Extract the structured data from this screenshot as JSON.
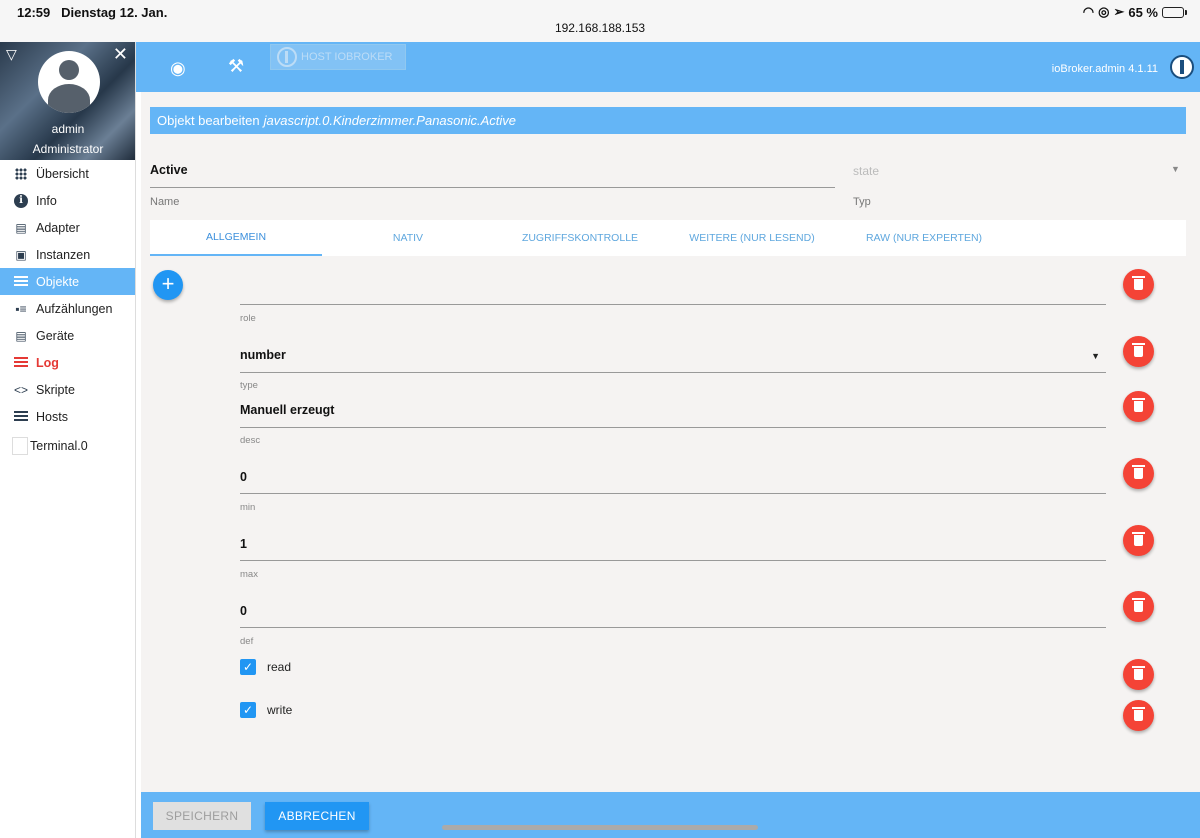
{
  "status_bar": {
    "time": "12:59",
    "date": "Dienstag 12. Jan.",
    "url": "192.168.188.153",
    "battery": "65 %",
    "battery_level": 0.65
  },
  "sidebar": {
    "user_name": "admin",
    "user_role": "Administrator",
    "items": [
      {
        "label": "Übersicht",
        "icon": "apps-grid-icon"
      },
      {
        "label": "Info",
        "icon": "info-icon"
      },
      {
        "label": "Adapter",
        "icon": "store-icon"
      },
      {
        "label": "Instanzen",
        "icon": "instances-icon"
      },
      {
        "label": "Objekte",
        "icon": "list-icon",
        "active": true
      },
      {
        "label": "Aufzählungen",
        "icon": "enums-icon"
      },
      {
        "label": "Geräte",
        "icon": "devices-icon"
      },
      {
        "label": "Log",
        "icon": "log-icon",
        "highlight": true
      },
      {
        "label": "Skripte",
        "icon": "code-icon"
      },
      {
        "label": "Hosts",
        "icon": "hosts-icon"
      },
      {
        "label": "Terminal.0",
        "icon": "terminal-icon"
      }
    ]
  },
  "topbar": {
    "host_button": "HOST IOBROKER",
    "version": "ioBroker.admin 4.1.11"
  },
  "editor": {
    "title_prefix": "Objekt bearbeiten",
    "object_id": "javascript.0.Kinderzimmer.Panasonic.Active",
    "name_value": "Active",
    "name_label": "Name",
    "type_value": "state",
    "type_label": "Typ",
    "tabs": [
      "ALLGEMEIN",
      "NATIV",
      "ZUGRIFFSKONTROLLE",
      "WEITERE (NUR LESEND)",
      "RAW (NUR EXPERTEN)"
    ],
    "fields": [
      {
        "key": "role",
        "value": ""
      },
      {
        "key": "type",
        "value": "number"
      },
      {
        "key": "desc",
        "value": "Manuell erzeugt"
      },
      {
        "key": "min",
        "value": "0"
      },
      {
        "key": "max",
        "value": "1"
      },
      {
        "key": "def",
        "value": "0"
      }
    ],
    "checkboxes": [
      {
        "label": "read",
        "checked": true
      },
      {
        "label": "write",
        "checked": true
      }
    ]
  },
  "actions": {
    "save": "SPEICHERN",
    "cancel": "ABBRECHEN"
  },
  "colors": {
    "primary": "#64b5f6",
    "accent": "#2196f3",
    "danger": "#f44336",
    "log": "#e53935"
  }
}
